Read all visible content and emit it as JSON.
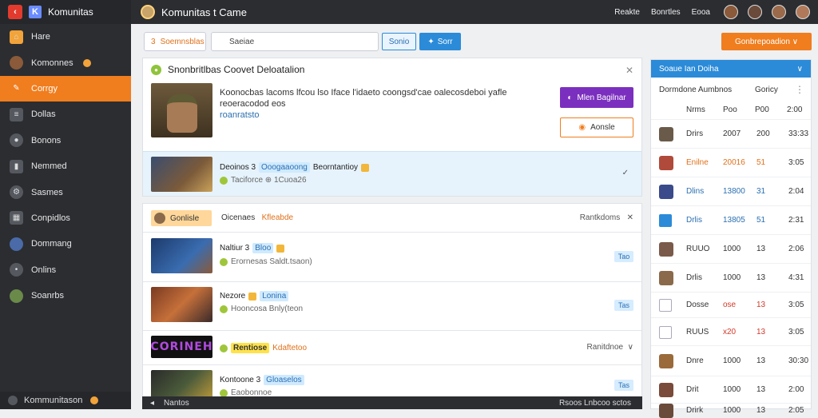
{
  "app": {
    "brand": "Komunitas",
    "title": "Komunitas t Came"
  },
  "sidebar": {
    "items": [
      {
        "label": "Hare",
        "icon": "home-icon"
      },
      {
        "label": "Komonnes",
        "icon": "user-avatar-icon"
      },
      {
        "label": "Corrgy",
        "icon": "lightning-icon",
        "active": true
      },
      {
        "label": "Dollas",
        "icon": "list-icon"
      },
      {
        "label": "Bonons",
        "icon": "coin-icon"
      },
      {
        "label": "Nemmed",
        "icon": "bookmark-icon"
      },
      {
        "label": "Sasmes",
        "icon": "gear-icon"
      },
      {
        "label": "Conpidlos",
        "icon": "grid-icon"
      },
      {
        "label": "Dommang",
        "icon": "user-avatar-icon"
      },
      {
        "label": "Onlins",
        "icon": "dot-icon"
      },
      {
        "label": "Soanrbs",
        "icon": "user-avatar-icon"
      }
    ],
    "footer": "Kommunitason"
  },
  "topbar": {
    "links": [
      "Reakte",
      "Bonrtles",
      "Eooa"
    ]
  },
  "toolbar": {
    "tab_label": "Soemnsblas",
    "search_value": "Saeiae",
    "btn_outline": "Sonio",
    "btn_blue": "Sorr",
    "btn_orange": "Gonbrepoadion ∨"
  },
  "card1": {
    "title": "Snonbritlbas Coovet Deloatalion",
    "text": "Koonocbas lacoms lfcou  lso Iface l'idaeto coongsd'cae oalecosdeboi yafle reoeracodod eos",
    "link": "roanratsto",
    "btn_purple": "Mlen Bagilnar",
    "btn_orange_outline": "Aonsle",
    "highlight": {
      "title": "Deoinos 3",
      "tag": "Ooogaaoong",
      "suffix": "Beorntantioy",
      "sub": "Taciforce  ⊕ 1Cuoa26"
    }
  },
  "card2": {
    "header_pill": "Gonlisle",
    "header_mid": "Oicenaes",
    "header_mid_orange": "Kfleabde",
    "header_right": "Rantkdoms",
    "rows": [
      {
        "title": "Naltiur 3",
        "tag": "Bloo",
        "sub": "Erornesas  Saldt.tsaon)",
        "badge": "Tao"
      },
      {
        "title": "Nezore",
        "tag": "Lonina",
        "sub": "Hooncosa  Bnly(teon",
        "badge": "Tas"
      },
      {
        "title": "Rentiose",
        "tag": "Kdaftetoo",
        "sub": "",
        "right": "Ranitdnoe",
        "logo": "CORINEH"
      },
      {
        "title": "Kontoone 3",
        "tag": "Gloaselos",
        "sub": "Eaobonnoe",
        "badge": "Tas"
      }
    ]
  },
  "bottombar": {
    "left": "Nantos",
    "right": "Rsoos Lnbcoo sctos"
  },
  "panel": {
    "header": "Soaue Ian Doiha",
    "cols": {
      "c1": "Dormdone Aumbnos",
      "c2": "Goricy"
    },
    "sub_cols": {
      "a": "Nrms",
      "b": "Poo",
      "c": "P00",
      "d": "2:00"
    },
    "rows": [
      {
        "name": "Drirs",
        "v1": "2007",
        "v2": "200",
        "v3": "33:33",
        "style": "normal"
      },
      {
        "name": "Enilne",
        "v1": "20016",
        "v2": "51",
        "v3": "3:05",
        "style": "orange"
      },
      {
        "name": "Dlins",
        "v1": "13800",
        "v2": "31",
        "v3": "2:04",
        "style": "blue"
      },
      {
        "name": "Drlis",
        "v1": "13805",
        "v2": "51",
        "v3": "2:31",
        "style": "blue"
      },
      {
        "name": "RUUO",
        "v1": "1000",
        "v2": "13",
        "v3": "2:06",
        "style": "normal"
      },
      {
        "name": "Drlis",
        "v1": "1000",
        "v2": "13",
        "v3": "4:31",
        "style": "normal"
      },
      {
        "name": "Dosse",
        "v1": "ose",
        "v2": "13",
        "v3": "3:05",
        "style": "red"
      },
      {
        "name": "RUUS",
        "v1": "x20",
        "v2": "13",
        "v3": "3:05",
        "style": "red"
      },
      {
        "name": "Dnre",
        "v1": "1000",
        "v2": "13",
        "v3": "30:30",
        "style": "normal"
      },
      {
        "name": "Drit",
        "v1": "1000",
        "v2": "13",
        "v3": "2:00",
        "style": "normal"
      },
      {
        "name": "Drirk",
        "v1": "1000",
        "v2": "13",
        "v3": "2:05",
        "style": "normal"
      }
    ]
  },
  "colors": {
    "accent": "#f07d1e",
    "primary": "#2b8bd8",
    "sidebar": "#2b2d31"
  }
}
